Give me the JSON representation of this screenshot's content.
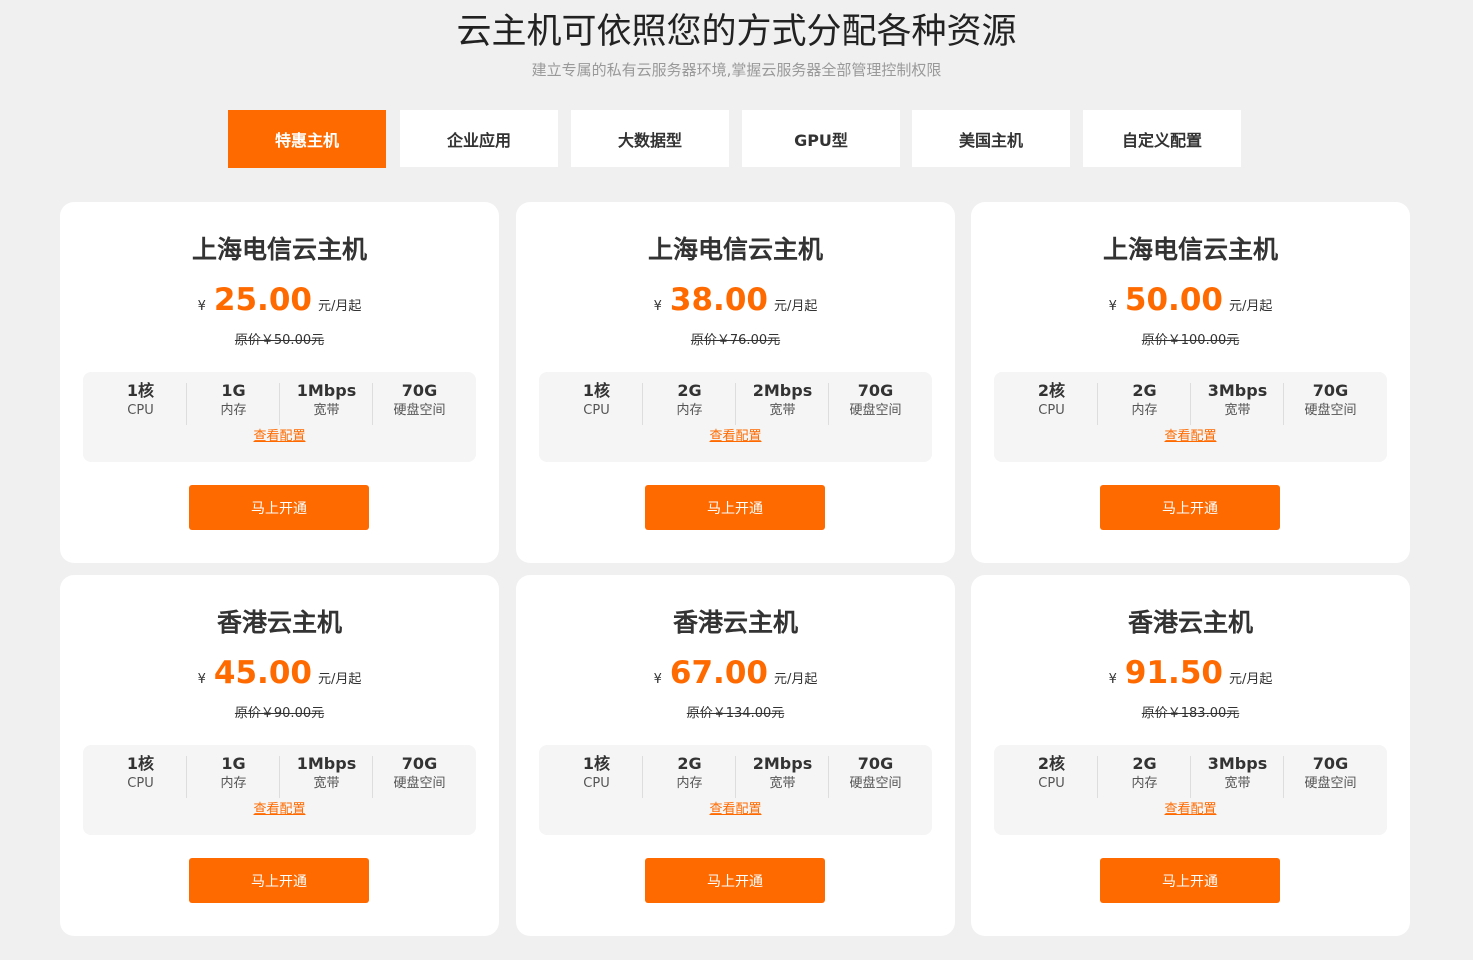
{
  "header": {
    "title": "云主机可依照您的方式分配各种资源",
    "subtitle": "建立专属的私有云服务器环境,掌握云服务器全部管理控制权限"
  },
  "tabs": [
    {
      "label": "特惠主机",
      "active": true
    },
    {
      "label": "企业应用",
      "active": false
    },
    {
      "label": "大数据型",
      "active": false
    },
    {
      "label": "GPU型",
      "active": false
    },
    {
      "label": "美国主机",
      "active": false
    },
    {
      "label": "自定义配置",
      "active": false
    }
  ],
  "cards": [
    {
      "title": "上海电信云主机",
      "currency": "¥",
      "price": "25.00",
      "unit": "元/月起",
      "original_price": "原价￥50.00元",
      "specs": [
        {
          "value": "1核",
          "label": "CPU"
        },
        {
          "value": "1G",
          "label": "内存"
        },
        {
          "value": "1Mbps",
          "label": "宽带"
        },
        {
          "value": "70G",
          "label": "硬盘空间"
        }
      ],
      "config_link": "查看配置",
      "button": "马上开通"
    },
    {
      "title": "上海电信云主机",
      "currency": "¥",
      "price": "38.00",
      "unit": "元/月起",
      "original_price": "原价￥76.00元",
      "specs": [
        {
          "value": "1核",
          "label": "CPU"
        },
        {
          "value": "2G",
          "label": "内存"
        },
        {
          "value": "2Mbps",
          "label": "宽带"
        },
        {
          "value": "70G",
          "label": "硬盘空间"
        }
      ],
      "config_link": "查看配置",
      "button": "马上开通"
    },
    {
      "title": "上海电信云主机",
      "currency": "¥",
      "price": "50.00",
      "unit": "元/月起",
      "original_price": "原价￥100.00元",
      "specs": [
        {
          "value": "2核",
          "label": "CPU"
        },
        {
          "value": "2G",
          "label": "内存"
        },
        {
          "value": "3Mbps",
          "label": "宽带"
        },
        {
          "value": "70G",
          "label": "硬盘空间"
        }
      ],
      "config_link": "查看配置",
      "button": "马上开通"
    },
    {
      "title": "香港云主机",
      "currency": "¥",
      "price": "45.00",
      "unit": "元/月起",
      "original_price": "原价￥90.00元",
      "specs": [
        {
          "value": "1核",
          "label": "CPU"
        },
        {
          "value": "1G",
          "label": "内存"
        },
        {
          "value": "1Mbps",
          "label": "宽带"
        },
        {
          "value": "70G",
          "label": "硬盘空间"
        }
      ],
      "config_link": "查看配置",
      "button": "马上开通"
    },
    {
      "title": "香港云主机",
      "currency": "¥",
      "price": "67.00",
      "unit": "元/月起",
      "original_price": "原价￥134.00元",
      "specs": [
        {
          "value": "1核",
          "label": "CPU"
        },
        {
          "value": "2G",
          "label": "内存"
        },
        {
          "value": "2Mbps",
          "label": "宽带"
        },
        {
          "value": "70G",
          "label": "硬盘空间"
        }
      ],
      "config_link": "查看配置",
      "button": "马上开通"
    },
    {
      "title": "香港云主机",
      "currency": "¥",
      "price": "91.50",
      "unit": "元/月起",
      "original_price": "原价￥183.00元",
      "specs": [
        {
          "value": "2核",
          "label": "CPU"
        },
        {
          "value": "2G",
          "label": "内存"
        },
        {
          "value": "3Mbps",
          "label": "宽带"
        },
        {
          "value": "70G",
          "label": "硬盘空间"
        }
      ],
      "config_link": "查看配置",
      "button": "马上开通"
    }
  ],
  "colors": {
    "accent": "#ff6a00",
    "background": "#f0f0f0",
    "card": "#ffffff",
    "spec_box": "#f5f5f5"
  }
}
